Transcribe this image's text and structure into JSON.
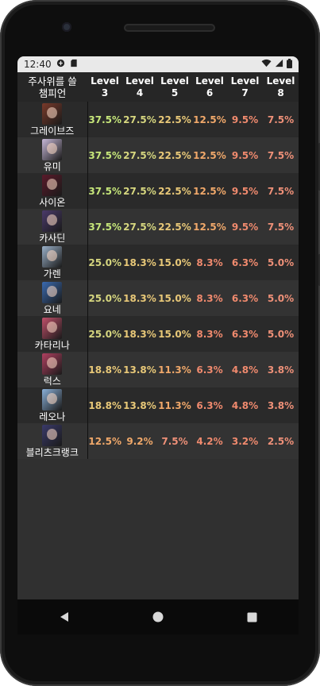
{
  "status": {
    "time": "12:40"
  },
  "header": {
    "champ_col": [
      "주사위를 쓸",
      "챔피언"
    ],
    "levels": [
      [
        "Level",
        "3"
      ],
      [
        "Level",
        "4"
      ],
      [
        "Level",
        "5"
      ],
      [
        "Level",
        "6"
      ],
      [
        "Level",
        "7"
      ],
      [
        "Level",
        "8"
      ]
    ]
  },
  "rows": [
    {
      "name": "그레이브즈",
      "avatar_color": "#7a3a2a",
      "values": [
        "37.5%",
        "27.5%",
        "22.5%",
        "12.5%",
        "9.5%",
        "7.5%"
      ]
    },
    {
      "name": "유미",
      "avatar_color": "#c7b8d8",
      "values": [
        "37.5%",
        "27.5%",
        "22.5%",
        "12.5%",
        "9.5%",
        "7.5%"
      ]
    },
    {
      "name": "사이온",
      "avatar_color": "#5a1a2a",
      "values": [
        "37.5%",
        "27.5%",
        "22.5%",
        "12.5%",
        "9.5%",
        "7.5%"
      ]
    },
    {
      "name": "카사딘",
      "avatar_color": "#4a3a6a",
      "values": [
        "37.5%",
        "27.5%",
        "22.5%",
        "12.5%",
        "9.5%",
        "7.5%"
      ]
    },
    {
      "name": "가렌",
      "avatar_color": "#9ab0c8",
      "values": [
        "25.0%",
        "18.3%",
        "15.0%",
        "8.3%",
        "6.3%",
        "5.0%"
      ]
    },
    {
      "name": "요네",
      "avatar_color": "#3a6ab0",
      "values": [
        "25.0%",
        "18.3%",
        "15.0%",
        "8.3%",
        "6.3%",
        "5.0%"
      ]
    },
    {
      "name": "카타리나",
      "avatar_color": "#c0506a",
      "values": [
        "25.0%",
        "18.3%",
        "15.0%",
        "8.3%",
        "6.3%",
        "5.0%"
      ]
    },
    {
      "name": "럭스",
      "avatar_color": "#b04060",
      "values": [
        "18.8%",
        "13.8%",
        "11.3%",
        "6.3%",
        "4.8%",
        "3.8%"
      ]
    },
    {
      "name": "레오나",
      "avatar_color": "#8ab0d8",
      "values": [
        "18.8%",
        "13.8%",
        "11.3%",
        "6.3%",
        "4.8%",
        "3.8%"
      ]
    },
    {
      "name": "블리츠크랭크",
      "avatar_color": "#3a3a6a",
      "values": [
        "12.5%",
        "9.2%",
        "7.5%",
        "4.2%",
        "3.2%",
        "2.5%"
      ]
    }
  ],
  "value_colors": {
    "37.5%": "c-green",
    "27.5%": "c-lime",
    "22.5%": "c-yellow",
    "12.5%": "c-orange",
    "9.5%": "c-red",
    "7.5%": "c-salmon",
    "25.0%": "c-lime",
    "18.3%": "c-yellow",
    "15.0%": "c-yellow",
    "8.3%": "c-red",
    "6.3%": "c-red",
    "5.0%": "c-salmon",
    "18.8%": "c-yellow",
    "13.8%": "c-yellow",
    "11.3%": "c-orange",
    "4.8%": "c-red",
    "3.8%": "c-salmon",
    "9.2%": "c-orange",
    "4.2%": "c-red",
    "3.2%": "c-red",
    "2.5%": "c-salmon"
  },
  "nav": {
    "back_icon": "back-triangle-icon",
    "home_icon": "home-circle-icon",
    "recents_icon": "recents-square-icon"
  }
}
